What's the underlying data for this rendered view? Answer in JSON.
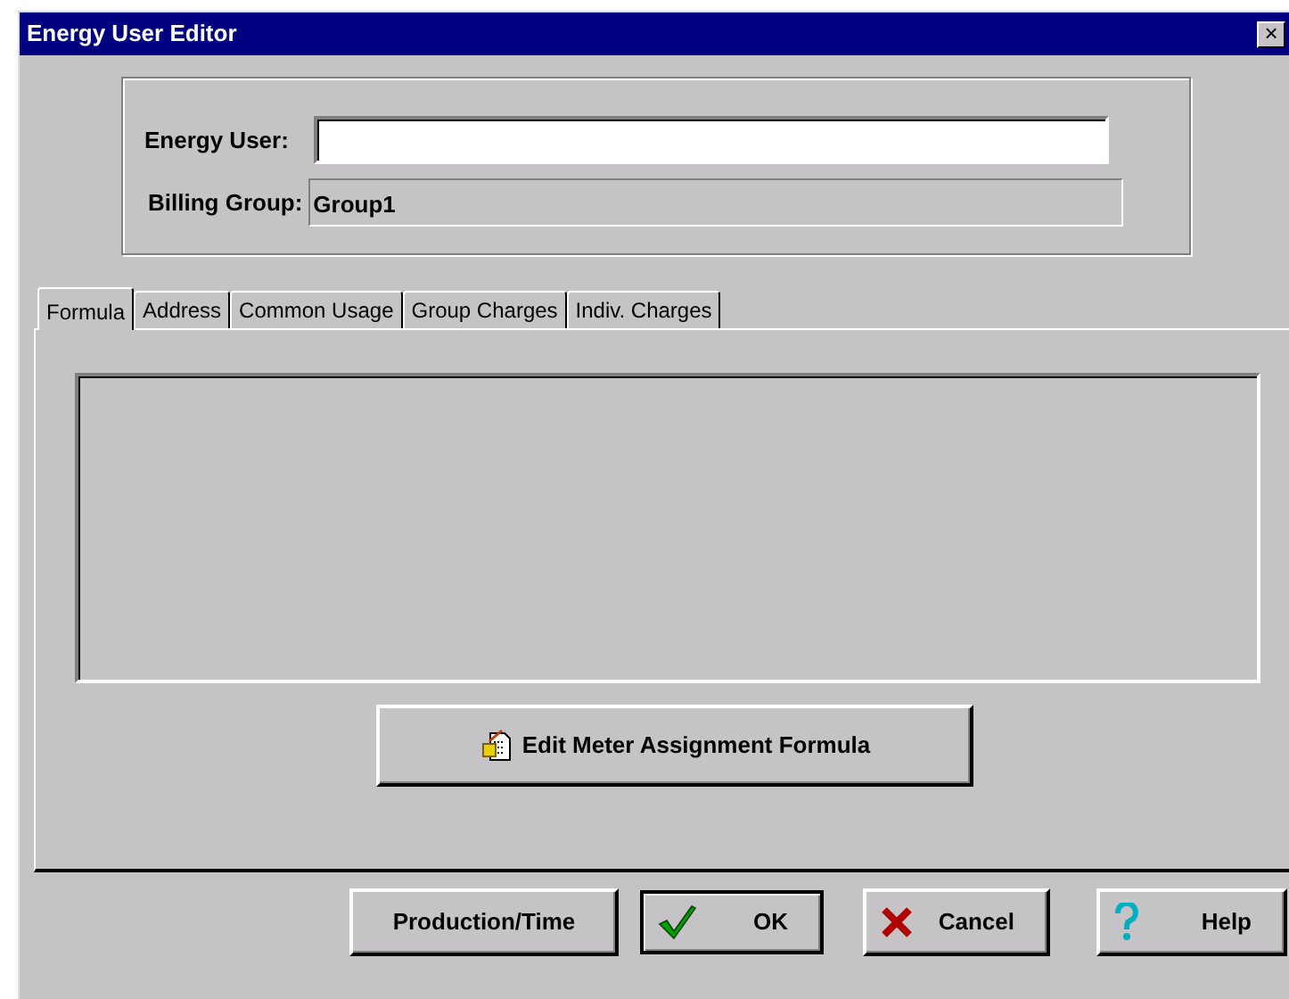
{
  "window": {
    "title": "Energy User Editor",
    "close": "×"
  },
  "fields": [
    {
      "kind": "input",
      "label": "Energy User:"
    },
    {
      "kind": "readonly",
      "label": "Billing Group:",
      "value": "Group1"
    }
  ],
  "tabs": [
    {
      "label": "Formula",
      "selected": true
    },
    {
      "label": "Address",
      "selected": false
    },
    {
      "label": "Common Usage",
      "selected": false
    },
    {
      "label": "Group Charges",
      "selected": false
    },
    {
      "label": "Indiv. Charges",
      "selected": false
    }
  ],
  "formula_button": "Edit Meter Assignment Formula",
  "buttons": [
    {
      "kind": "plain",
      "label": "Production/Time",
      "default": false
    },
    {
      "kind": "ok",
      "label": "OK",
      "default": true
    },
    {
      "kind": "cancel",
      "label": "Cancel",
      "default": false
    },
    {
      "kind": "help",
      "label": "Help",
      "default": false
    }
  ]
}
